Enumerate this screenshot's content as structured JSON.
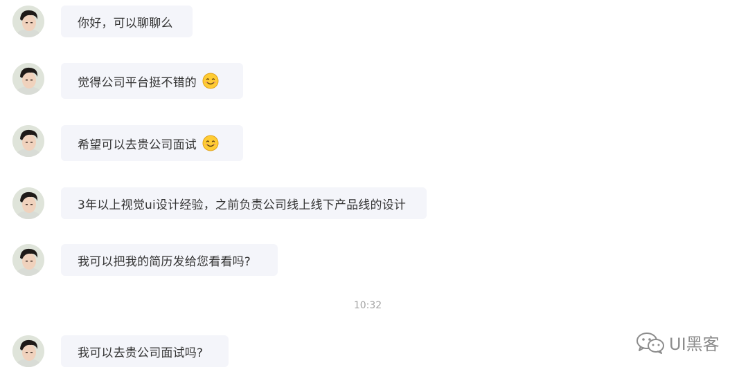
{
  "messages": [
    {
      "text": "你好，可以聊聊么",
      "emoji": null
    },
    {
      "text": "觉得公司平台挺不错的",
      "emoji": "smile-emoji"
    },
    {
      "text": "希望可以去贵公司面试",
      "emoji": "smile-emoji"
    },
    {
      "text": "3年以上视觉ui设计经验，之前负责公司线上线下产品线的设计",
      "emoji": null
    },
    {
      "text": "我可以把我的简历发给您看看吗?",
      "emoji": null
    },
    {
      "text": "我可以去贵公司面试吗?",
      "emoji": null
    }
  ],
  "timestamp": "10:32",
  "watermark": {
    "icon": "wechat-icon",
    "text": "UI黑客"
  },
  "colors": {
    "bubble": "#f4f5fa",
    "text": "#333333",
    "timestamp": "#a3a3a3",
    "watermark": "#8c8c8c"
  }
}
